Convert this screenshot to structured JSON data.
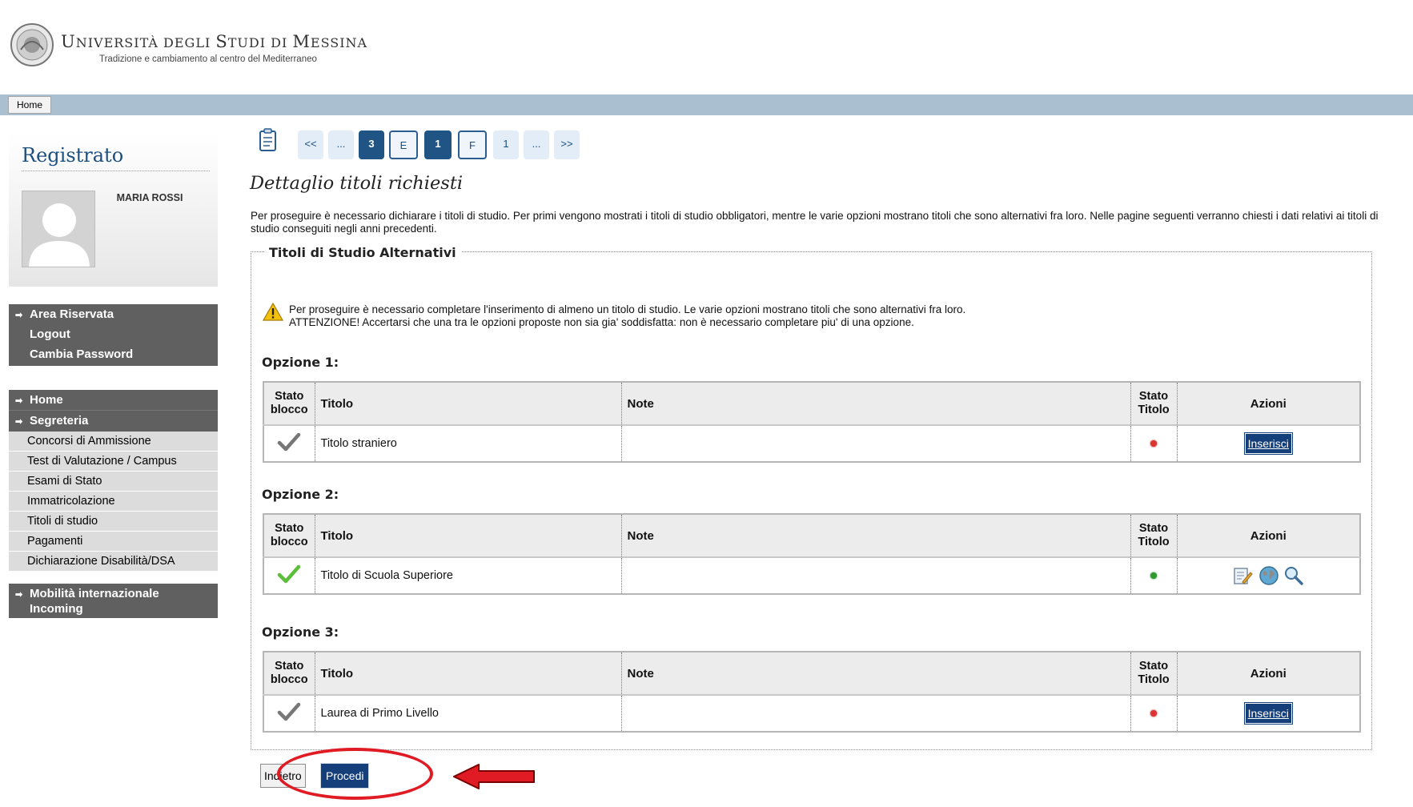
{
  "header": {
    "university_name_parts": {
      "u": "U",
      "niversita": "NIVERSITÀ ",
      "degli": "DEGLI ",
      "s": "S",
      "tudi": "TUDI ",
      "di": "DI ",
      "m": "M",
      "essina": "ESSINA"
    },
    "tagline": "Tradizione e cambiamento al centro del Mediterraneo"
  },
  "topbar": {
    "home_label": "Home"
  },
  "user_panel": {
    "title": "Registrato",
    "user_name": "MARIA ROSSI"
  },
  "reserved_menu": {
    "head": "Area Riservata",
    "items": [
      "Logout",
      "Cambia Password"
    ]
  },
  "main_menu": {
    "home": "Home",
    "segreteria": "Segreteria",
    "items": [
      "Concorsi di Ammissione",
      "Test di Valutazione / Campus",
      "Esami di Stato",
      "Immatricolazione",
      "Titoli di studio",
      "Pagamenti",
      "Dichiarazione Disabilità/DSA"
    ],
    "mobilita_line1": "Mobilità internazionale",
    "mobilita_line2": "Incoming"
  },
  "pager": {
    "items": [
      "<<",
      "...",
      "3",
      "E",
      "1",
      "F",
      "1",
      "...",
      ">>"
    ]
  },
  "page": {
    "title": "Dettaglio titoli richiesti",
    "intro": "Per proseguire è necessario dichiarare i titoli di studio. Per primi vengono mostrati i titoli di studio obbligatori, mentre le varie opzioni mostrano titoli che sono alternativi fra loro. Nelle pagine seguenti verranno chiesti i dati relativi ai titoli di studio conseguiti negli anni precedenti.",
    "fieldset_legend": "Titoli di Studio Alternativi",
    "warning_line1": "Per proseguire è necessario completare l'inserimento di almeno un titolo di studio. Le varie opzioni mostrano titoli che sono alternativi fra loro.",
    "warning_line2": "ATTENZIONE! Accertarsi che una tra le opzioni proposte non sia gia' soddisfatta: non è necessario completare piu' di una opzione."
  },
  "table_headers": {
    "stato_blocco_1": "Stato",
    "stato_blocco_2": "blocco",
    "titolo": "Titolo",
    "note": "Note",
    "stato_titolo_1": "Stato",
    "stato_titolo_2": "Titolo",
    "azioni": "Azioni"
  },
  "options": [
    {
      "label": "Opzione 1:",
      "titolo": "Titolo straniero",
      "note": "",
      "stato": "red",
      "action": "Inserisci"
    },
    {
      "label": "Opzione 2:",
      "titolo": "Titolo di Scuola Superiore",
      "note": "",
      "stato": "green",
      "action_icons": [
        "edit-icon",
        "globe-icon",
        "search-icon"
      ]
    },
    {
      "label": "Opzione 3:",
      "titolo": "Laurea di Primo Livello",
      "note": "",
      "stato": "red",
      "action": "Inserisci"
    }
  ],
  "buttons": {
    "indietro": "Indietro",
    "procedi": "Procedi"
  },
  "colors": {
    "brand_blue": "#1f5485",
    "menu_dark": "#606060",
    "annotation_red": "#e01b24"
  }
}
